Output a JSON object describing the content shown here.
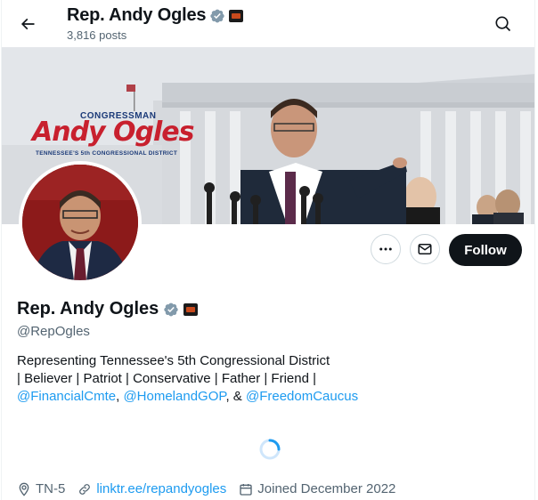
{
  "header": {
    "name": "Rep. Andy Ogles",
    "posts_count": "3,816 posts"
  },
  "banner": {
    "brand_top": "CONGRESSMAN",
    "brand_main": "Andy Ogles",
    "brand_sub": "TENNESSEE'S 5th CONGRESSIONAL DISTRICT"
  },
  "actions": {
    "follow_label": "Follow"
  },
  "profile": {
    "name": "Rep. Andy Ogles",
    "handle": "@RepOgles",
    "bio_line1": "Representing Tennessee's 5th Congressional District",
    "bio_line2": "| Believer | Patriot | Conservative | Father | Friend |",
    "mention1": "@FinancialCmte",
    "sep1": ", ",
    "mention2": "@HomelandGOP",
    "sep2": ", & ",
    "mention3": "@FreedomCaucus",
    "location": "TN-5",
    "website": "linktr.ee/repandyogles",
    "joined": "Joined December 2022"
  },
  "colors": {
    "accent": "#1d9bf0",
    "follow_bg": "#0f1419",
    "verified": "#829aab",
    "secondary_text": "#536471"
  },
  "icons": [
    "back-arrow-icon",
    "search-icon",
    "verified-badge-icon",
    "government-affiliation-icon",
    "more-icon",
    "mail-icon",
    "loading-spinner-icon",
    "location-icon",
    "link-icon",
    "calendar-icon"
  ]
}
